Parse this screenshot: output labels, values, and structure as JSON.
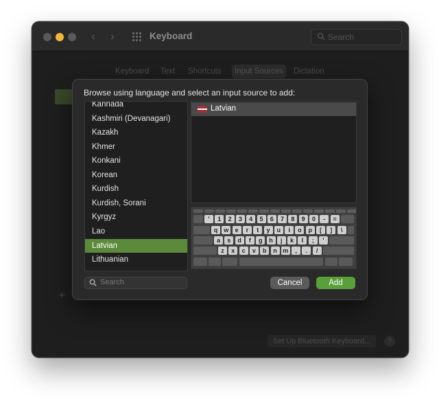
{
  "window": {
    "title": "Keyboard",
    "search_placeholder": "Search",
    "tabs": [
      "Keyboard",
      "Text",
      "Shortcuts",
      "Input Sources",
      "Dictation"
    ],
    "active_tab": "Input Sources",
    "bluetooth_button": "Set Up Bluetooth Keyboard...",
    "help_label": "?",
    "add_source_label": "+"
  },
  "dialog": {
    "title": "Browse using language and select an input source to add:",
    "languages": [
      "Kannada",
      "Kashmiri (Devanagari)",
      "Kazakh",
      "Khmer",
      "Konkani",
      "Korean",
      "Kurdish",
      "Kurdish, Sorani",
      "Kyrgyz",
      "Lao",
      "Latvian",
      "Lithuanian"
    ],
    "selected_language": "Latvian",
    "sources": [
      {
        "name": "Latvian",
        "flag": "latvia-flag"
      }
    ],
    "search_placeholder": "Search",
    "cancel_label": "Cancel",
    "add_label": "Add"
  },
  "keyboard_preview": {
    "rows": [
      [
        "'",
        "1",
        "2",
        "3",
        "4",
        "5",
        "6",
        "7",
        "8",
        "9",
        "0",
        "-",
        "="
      ],
      [
        "q",
        "w",
        "e",
        "r",
        "t",
        "y",
        "u",
        "i",
        "o",
        "p",
        "[",
        "]",
        "\\"
      ],
      [
        "a",
        "s",
        "d",
        "f",
        "g",
        "h",
        "j",
        "k",
        "l",
        ";",
        "'"
      ],
      [
        "z",
        "x",
        "c",
        "v",
        "b",
        "n",
        "m",
        ",",
        ".",
        "/"
      ]
    ]
  },
  "colors": {
    "accent_selection": "#5b8a3a",
    "add_button": "#5aa03a",
    "close_light": "#5a5a5a",
    "minimize_light": "#f5b73b"
  },
  "icons": [
    "back-chevron-icon",
    "forward-chevron-icon",
    "grid-icon",
    "search-icon",
    "latvia-flag"
  ]
}
